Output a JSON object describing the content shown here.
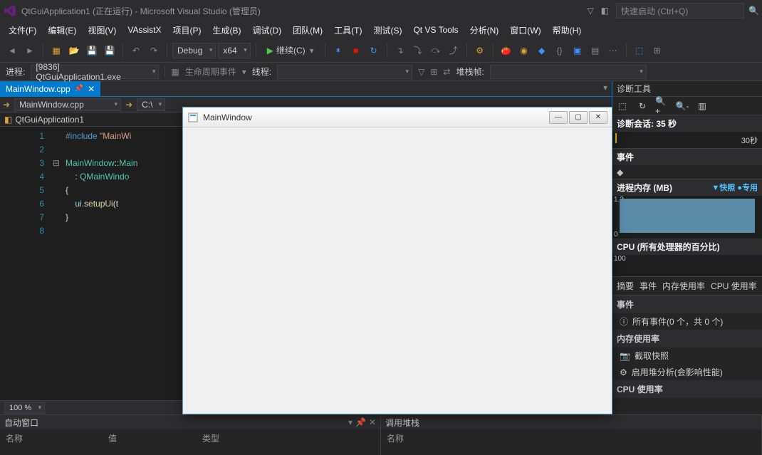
{
  "titleBar": {
    "text": "QtGuiApplication1 (正在运行) - Microsoft Visual Studio (管理员)",
    "quickLaunch": "快速启动 (Ctrl+Q)"
  },
  "menu": {
    "file": "文件(F)",
    "edit": "编辑(E)",
    "view": "视图(V)",
    "vax": "VAssistX",
    "project": "项目(P)",
    "build": "生成(B)",
    "debug": "调试(D)",
    "team": "团队(M)",
    "tools": "工具(T)",
    "test": "测试(S)",
    "qtvs": "Qt VS Tools",
    "analyze": "分析(N)",
    "window": "窗口(W)",
    "help": "帮助(H)"
  },
  "toolbar": {
    "config": "Debug",
    "platform": "x64",
    "continue": "继续(C)"
  },
  "processBar": {
    "label": "进程:",
    "process": "[9836] QtGuiApplication1.exe",
    "lifecycle": "生命周期事件",
    "threadLabel": "线程:",
    "stackLabel": "堆栈帧:"
  },
  "tabs": {
    "active": "MainWindow.cpp"
  },
  "navBar": {
    "scope": "MainWindow.cpp",
    "member": "C:\\"
  },
  "symbolBar": {
    "class": "QtGuiApplication1"
  },
  "code": {
    "lines": [
      "1",
      "2",
      "3",
      "4",
      "5",
      "6",
      "7",
      "8"
    ],
    "l1_kw": "#include",
    "l1_str": " \"MainWi",
    "l3_cls1": "MainWindow",
    "l3_sep": "::",
    "l3_mth": "Main",
    "l4_cls": "QMainWindo",
    "l5": "{",
    "l6_var": "ui",
    "l6_dot": ".",
    "l6_mth": "setupUi",
    "l6_arg": "(t",
    "l7": "}",
    "l4_colon": ": "
  },
  "zoom": {
    "level": "100 %"
  },
  "diag": {
    "title": "诊断工具",
    "session": "诊断会话: 35 秒",
    "tl30": "30秒",
    "events": "事件",
    "memHeader": "进程内存 (MB)",
    "snap": "▼快照  ●专用",
    "memTop": "1.3",
    "memBot": "0",
    "cpuHeader": "CPU (所有处理器的百分比)",
    "cpuTop": "100",
    "tab1": "摘要",
    "tab2": "事件",
    "tab3": "内存使用率",
    "tab4": "CPU 使用率",
    "sectEvents": "事件",
    "allEvents": "所有事件(0 个，共 0 个)",
    "sectMem": "内存使用率",
    "snapshot": "截取快照",
    "heap": "启用堆分析(会影响性能)",
    "sectCpu": "CPU 使用率"
  },
  "bottom": {
    "auto": "自动窗口",
    "colName": "名称",
    "colValue": "值",
    "colType": "类型",
    "callstack": "调用堆栈",
    "csName": "名称"
  },
  "qtWin": {
    "title": "MainWindow"
  },
  "chart_data": [
    {
      "type": "area",
      "title": "进程内存 (MB)",
      "ylim": [
        0,
        1.3
      ],
      "x": [
        0,
        35
      ],
      "values_approx": 1.2,
      "ylabel": "MB"
    },
    {
      "type": "line",
      "title": "CPU (所有处理器的百分比)",
      "ylim": [
        0,
        100
      ],
      "x": [
        0,
        35
      ],
      "values_approx": 0,
      "ylabel": "%"
    }
  ]
}
